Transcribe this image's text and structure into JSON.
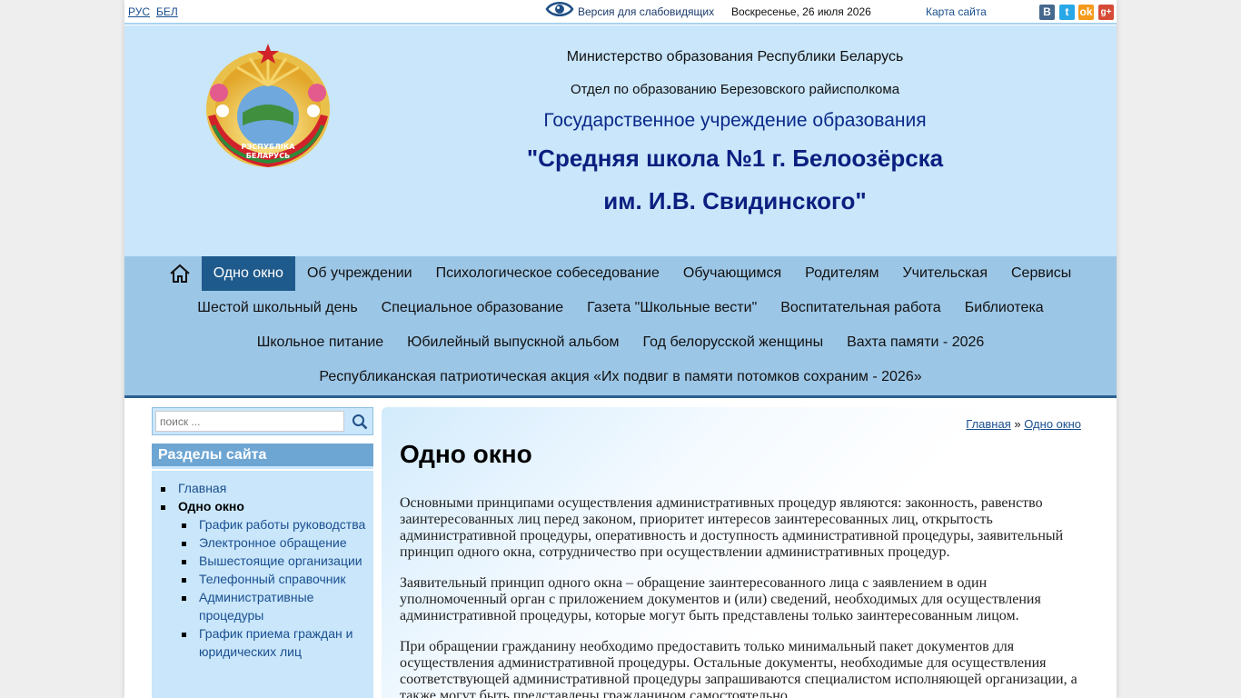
{
  "topbar": {
    "lang_ru": "РУС",
    "lang_be": "БЕЛ",
    "vision_label": "Версия для слабовидящих",
    "date": "Воскресенье, 26 июля 2026",
    "sitemap": "Карта сайта",
    "social": [
      {
        "icon": "vk-icon",
        "glyph": "В"
      },
      {
        "icon": "twitter-icon",
        "glyph": "t"
      },
      {
        "icon": "odnoklassniki-icon",
        "glyph": "ok"
      },
      {
        "icon": "google-plus-icon",
        "glyph": "g+"
      }
    ]
  },
  "header": {
    "ministry": "Министерство образования Республики Беларусь",
    "department": "Отдел по образованию Березовского райисполкома",
    "institution_type": "Государственное учреждение образования",
    "school_name_1": "\"Средняя школа №1 г. Белоозёрска",
    "school_name_2": "им. И.В. Свидинского\"",
    "emblem_text_1": "РЭСПУБЛІКА",
    "emblem_text_2": "БЕЛАРУСЬ"
  },
  "nav": {
    "home_icon": "home-icon",
    "row1": [
      "Одно окно",
      "Об учреждении",
      "Психологическое собеседование",
      "Обучающимся",
      "Родителям",
      "Учительская",
      "Сервисы"
    ],
    "row2": [
      "Шестой школьный день",
      "Специальное образование",
      "Газета \"Школьные вести\"",
      "Воспитательная работа",
      "Библиотека"
    ],
    "row3": [
      "Школьное питание",
      "Юбилейный выпускной альбом",
      "Год белорусской женщины",
      "Вахта памяти - 2026"
    ],
    "row4": [
      "Республиканская патриотическая акция «Их подвиг в памяти потомков сохраним - 2026»"
    ],
    "active": "Одно окно"
  },
  "sidebar": {
    "search_placeholder": "поиск ...",
    "sections_title": "Разделы сайта",
    "items": [
      {
        "label": "Главная"
      },
      {
        "label": "Одно окно",
        "current": true
      }
    ],
    "subitems": [
      "График работы руководства",
      "Электронное обращение",
      "Вышестоящие организации",
      "Телефонный справочник",
      "Административные процедуры",
      "График приема граждан и юридических лиц"
    ]
  },
  "content": {
    "breadcrumb_home": "Главная",
    "breadcrumb_sep": "»",
    "breadcrumb_current": "Одно окно",
    "title": "Одно окно",
    "paragraphs": [
      "Основными принципами осуществления административных процедур являются: законность, равенство заинтересованных лиц перед законом, приоритет интересов заинтересованных лиц, открытость административной процедуры, оперативность и доступность административной процедуры, заявительный принцип одного окна, сотрудничество при осуществлении административных процедур.",
      "Заявительный принцип одного окна – обращение заинтересованного лица с заявлением в один уполномоченный орган с приложением документов и (или) сведений, необходимых для осуществления административной процедуры, которые могут быть представлены только заинтересованным лицом.",
      "При обращении гражданину необходимо предоставить только минимальный пакет документов для осуществления административной процедуры. Остальные документы, необходимые для осуществления соответствующей административной процедуры запрашиваются специалистом исполняющей организации, а также могут быть представлены гражданином самостоятельно."
    ]
  },
  "colors": {
    "header_bg": "#c9e6fb",
    "nav_bg": "#9cc6e6",
    "nav_active": "#1f5a8c",
    "title_blue": "#0b1f80",
    "link": "#1a4f8f"
  }
}
